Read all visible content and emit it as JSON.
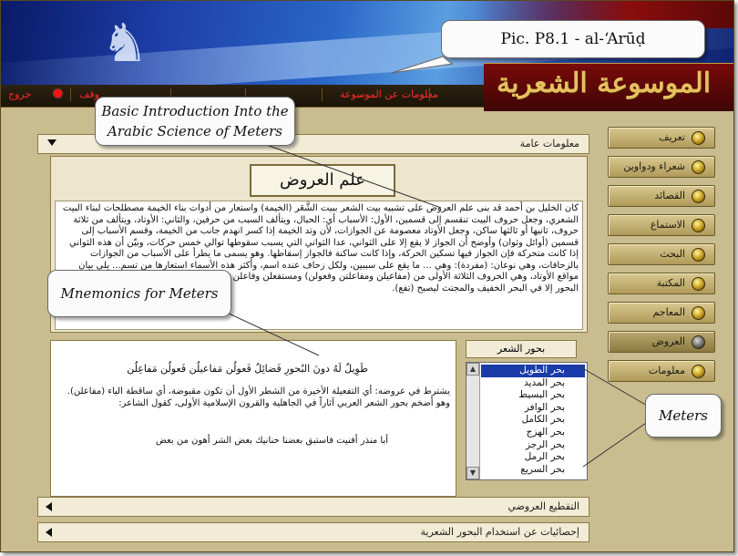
{
  "header": {
    "pic_label": "Pic. P8.1 - al-‘Arūḍ",
    "logo_text": "الموسوعة الشعرية"
  },
  "menu": {
    "exit": "خروج",
    "stop": "وقف",
    "about": "معلومات عن الموسوعة"
  },
  "sidebar": {
    "items": [
      {
        "label": "تعريف",
        "active": false
      },
      {
        "label": "شعراء ودواوين",
        "active": false
      },
      {
        "label": "القصائد",
        "active": false
      },
      {
        "label": "الاستماع",
        "active": false
      },
      {
        "label": "البحث",
        "active": false
      },
      {
        "label": "المكتبة",
        "active": false
      },
      {
        "label": "المعاجم",
        "active": false
      },
      {
        "label": "العروض",
        "active": true
      },
      {
        "label": "معلومات",
        "active": false
      }
    ]
  },
  "sections": {
    "general_info": "معلومات عامة",
    "scansion": "التقطيع العروضي",
    "statistics": "إحصائيات عن استخدام البحور الشعرية"
  },
  "panel": {
    "title": "علم العروض",
    "body": "كان الخليل بن أحمد قد بنى علم العروض على تشبيه بيت الشعر ببيت الشَّعَر (الخيمة) واستعار من أدوات بناء الخيمة مصطلحات لبناء البيت الشعري، وجعل حروف البيت تنقسم إلى قسمين، الأول: الأسباب أي: الحبال، ويتألف السبب من حرفين، والثاني: الأوتاد، ويتألف من ثلاثة حروف، ثانيها أو ثالثها ساكن، وجعل الأوتاد معصومة عن الجوازات، لأن وتد الخيمة إذا كسر انهدم جانب من الخيمة، وقسم الأسباب إلى قسمين (أوائل وثوان) وأوضح أن الجواز لا يقع إلا على الثواني، عدا الثواني التي يسبب سقوطها توالي خمس حركات، وبيّن أن هذه الثواني إذا كانت متحركة فإن الجواز فيها تسكين الحركة، وإذا كانت ساكنة فالجواز إسقاطها. وهو يسمى ما يطرأ على الأسباب من الجوازات بالزحافات، وهي نوعان: (مفردة): وهي ... ما يقع على سببين، ولكل زحاف عنده اسم، وأكثر هذه الأسماء استعارها من تسم... يلي بيان مواقع الأوتاد، وهي الحروف الثلاثة الأولى من (مفاعيلن ومفاعلتن وفعولن) ومستفعلن وفاعلن ومفعولات). أما فاعلاتن فوتدها (علا) في كل البحور إلا في البحر الخفيف والمجتث ليصبح (تفع)."
  },
  "poem": {
    "verse": "طَوِيلٌ لَهُ دونَ البُحورِ فَضائِلُ   فَعولُن مَفاعيلُن فَعولُن مَفاعِلُن",
    "paragraph": "يشترط في عروضه: أي التفعيلة الأخيرة من الشطر الأول أن تكون مقبوضة، أي ساقطة الياء (مفاعلن). وهو أضخم بحور الشعر العربي آثاراً في الجاهلية والقرون الإسلامية الأولى، كقول الشاعر:",
    "line": "أبا منذر أفنيت فاستبق بعضنا    حنانيك بعض الشر أهون من بعض"
  },
  "meters": {
    "label": "بحور الشعر",
    "items": [
      "بحر الطويل",
      "بحر المديد",
      "بحر البسيط",
      "بحر الوافر",
      "بحر الكامل",
      "بحر الهزج",
      "بحر الرجز",
      "بحر الرمل",
      "بحر السريع"
    ],
    "selected_index": 0
  },
  "callouts": {
    "intro": "Basic Introduction Into the Arabic Science of Meters",
    "mnemonics": "Mnemonics for Meters",
    "meters": "Meters"
  },
  "colors": {
    "accent_red": "#ff2a2a",
    "selection_blue": "#1a3ca8",
    "panel_bg": "#c9bd90"
  }
}
